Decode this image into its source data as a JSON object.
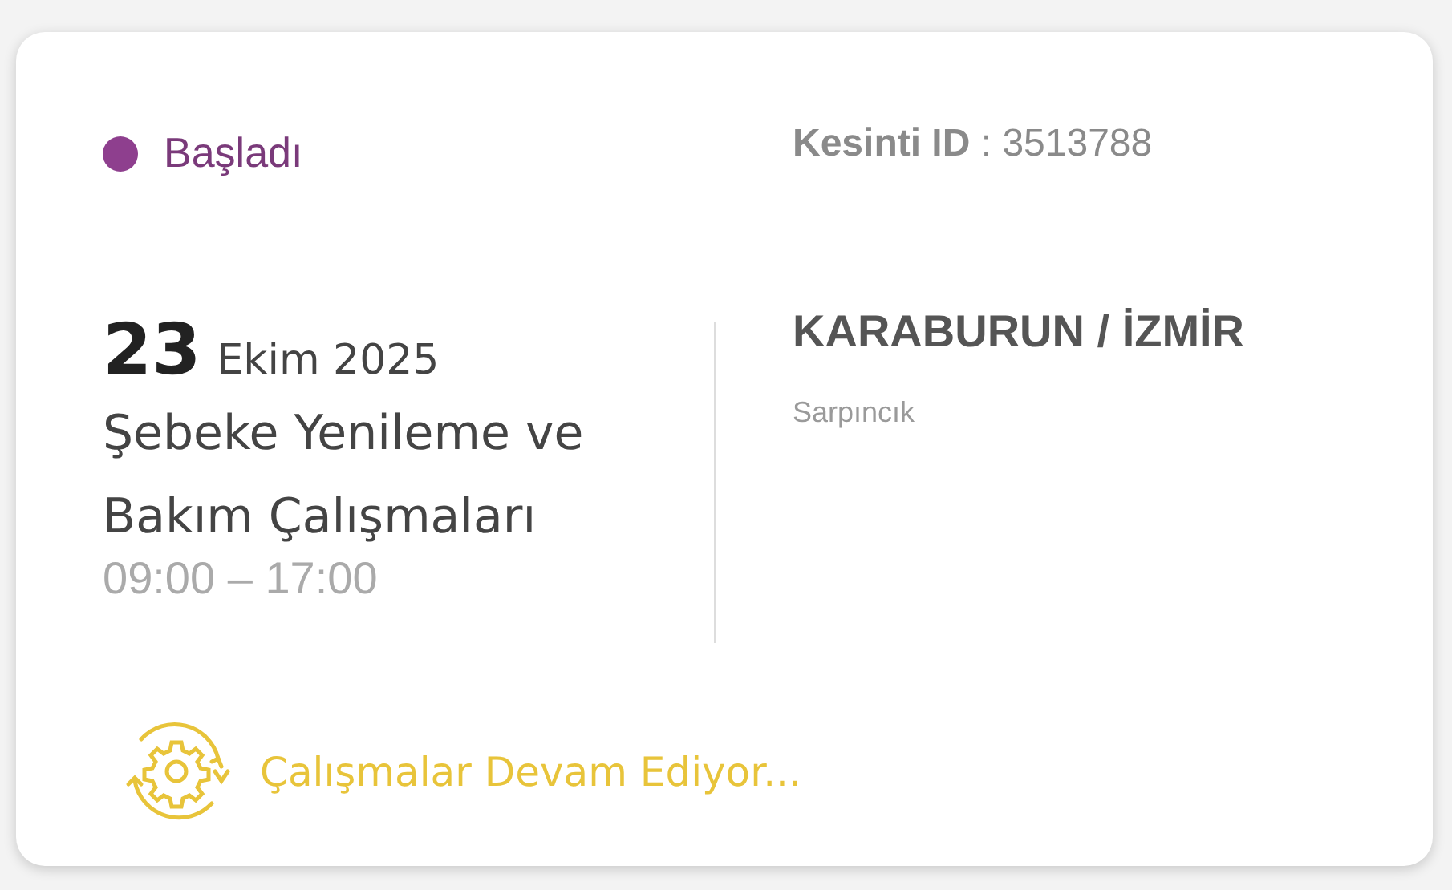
{
  "status": {
    "label": "Başladı",
    "color": "#8e3f8e"
  },
  "outage_id": "**Kesinti ID** : 3513788",
  "date": {
    "day": "23",
    "month_year": "Ekim 2025"
  },
  "title": "Şebeke Yenileme ve Bakım Çalışmaları",
  "time": "09:00 – 17:00",
  "location": "KARABURUN / İZMİR",
  "district": "Sarpıncık",
  "progress": {
    "label": "Çalışmalar Devam Ediyor..."
  }
}
